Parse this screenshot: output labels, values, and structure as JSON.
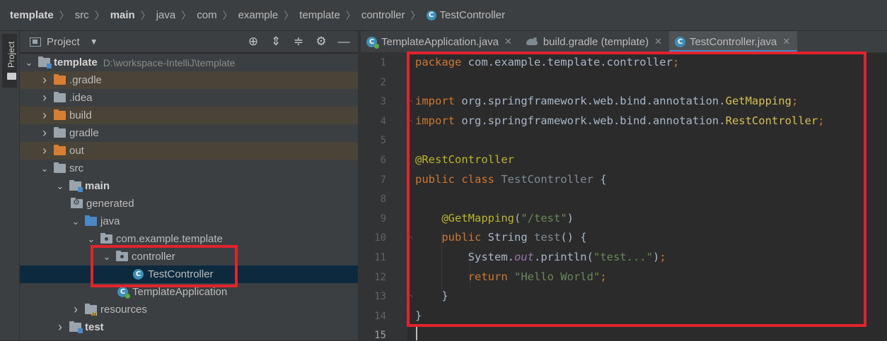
{
  "breadcrumb": [
    {
      "label": "template",
      "bold": true
    },
    {
      "label": "src",
      "bold": false
    },
    {
      "label": "main",
      "bold": true
    },
    {
      "label": "java",
      "bold": false
    },
    {
      "label": "com",
      "bold": false
    },
    {
      "label": "example",
      "bold": false
    },
    {
      "label": "template",
      "bold": false
    },
    {
      "label": "controller",
      "bold": false
    },
    {
      "label": "TestController",
      "bold": false,
      "class_icon": true
    }
  ],
  "tool_strip": {
    "project_label": "Project"
  },
  "project_panel": {
    "title": "Project",
    "toolbar_icons": [
      "crosshair-icon",
      "expand-all-icon",
      "collapse-all-icon",
      "settings-icon",
      "hide-icon"
    ]
  },
  "tree": [
    {
      "label": "template",
      "hint": "D:\\workspace-IntelliJ\\template",
      "bold": true,
      "arrow": "down",
      "folder": "module",
      "indent": 0
    },
    {
      "label": ".gradle",
      "arrow": "right",
      "folder": "orange",
      "indent": 1,
      "excluded": true
    },
    {
      "label": ".idea",
      "arrow": "right",
      "folder": "gray",
      "indent": 1
    },
    {
      "label": "build",
      "arrow": "right",
      "folder": "orange",
      "indent": 1,
      "excluded": true
    },
    {
      "label": "gradle",
      "arrow": "right",
      "folder": "gray",
      "indent": 1
    },
    {
      "label": "out",
      "arrow": "right",
      "folder": "orange",
      "indent": 1,
      "excluded": true
    },
    {
      "label": "src",
      "arrow": "down",
      "folder": "gray",
      "indent": 1
    },
    {
      "label": "main",
      "bold": true,
      "arrow": "down",
      "folder": "module",
      "indent": 2
    },
    {
      "label": "generated",
      "arrow": "none",
      "folder": "gen",
      "indent": 3
    },
    {
      "label": "java",
      "arrow": "down",
      "folder": "blue",
      "indent": 3
    },
    {
      "label": "com.example.template",
      "arrow": "down",
      "folder": "pkg",
      "indent": 4
    },
    {
      "label": "controller",
      "arrow": "down",
      "folder": "pkg",
      "indent": 5
    },
    {
      "label": "TestController",
      "arrow": "none",
      "folder": "class",
      "indent": 7,
      "selected": true
    },
    {
      "label": "TemplateApplication",
      "arrow": "none",
      "folder": "app",
      "indent": 6
    },
    {
      "label": "resources",
      "arrow": "right",
      "folder": "res",
      "indent": 3
    },
    {
      "label": "test",
      "bold": true,
      "arrow": "right",
      "folder": "module",
      "indent": 2
    }
  ],
  "tabs": [
    {
      "label": "TemplateApplication.java",
      "icon": "app",
      "active": false
    },
    {
      "label": "build.gradle (template)",
      "icon": "gradle",
      "active": false
    },
    {
      "label": "TestController.java",
      "icon": "class",
      "active": true
    }
  ],
  "tab_close_glyph": "✕",
  "code_lines": [
    {
      "n": "1",
      "tokens": [
        [
          "kw",
          "package "
        ],
        [
          "plain",
          "com.example.template.controller"
        ],
        [
          "kw",
          ";"
        ]
      ]
    },
    {
      "n": "2",
      "tokens": []
    },
    {
      "n": "3",
      "tokens": [
        [
          "kw",
          "import "
        ],
        [
          "plain",
          "org.springframework.web.bind.annotation."
        ],
        [
          "yellow",
          "GetMapping"
        ],
        [
          "kw",
          ";"
        ]
      ]
    },
    {
      "n": "4",
      "tokens": [
        [
          "kw",
          "import "
        ],
        [
          "plain",
          "org.springframework.web.bind.annotation."
        ],
        [
          "yellow",
          "RestController"
        ],
        [
          "kw",
          ";"
        ]
      ]
    },
    {
      "n": "5",
      "tokens": []
    },
    {
      "n": "6",
      "tokens": [
        [
          "ann",
          "@RestController"
        ]
      ]
    },
    {
      "n": "7",
      "tokens": [
        [
          "kw",
          "public class "
        ],
        [
          "dim",
          "TestController "
        ],
        [
          "plain",
          "{"
        ]
      ]
    },
    {
      "n": "8",
      "tokens": []
    },
    {
      "n": "9",
      "tokens": [
        [
          "plain",
          "    "
        ],
        [
          "ann",
          "@GetMapping"
        ],
        [
          "plain",
          "("
        ],
        [
          "str",
          "\"/test\""
        ],
        [
          "plain",
          ")"
        ]
      ]
    },
    {
      "n": "10",
      "tokens": [
        [
          "plain",
          "    "
        ],
        [
          "kw",
          "public "
        ],
        [
          "plain",
          "String "
        ],
        [
          "dim",
          "test"
        ],
        [
          "plain",
          "() {"
        ]
      ]
    },
    {
      "n": "11",
      "tokens": [
        [
          "plain",
          "        System."
        ],
        [
          "italic",
          "out"
        ],
        [
          "plain",
          ".println("
        ],
        [
          "str",
          "\"test...\""
        ],
        [
          "plain",
          ")"
        ],
        [
          "kw",
          ";"
        ]
      ]
    },
    {
      "n": "12",
      "tokens": [
        [
          "plain",
          "        "
        ],
        [
          "kw",
          "return "
        ],
        [
          "str",
          "\"Hello World\""
        ],
        [
          "kw",
          ";"
        ]
      ]
    },
    {
      "n": "13",
      "tokens": [
        [
          "plain",
          "    }"
        ]
      ]
    },
    {
      "n": "14",
      "tokens": [
        [
          "plain",
          "}"
        ]
      ]
    },
    {
      "n": "15",
      "tokens": []
    }
  ],
  "current_line": "15",
  "colors": {
    "highlight_box": "#e0232d",
    "selection": "#0d293e",
    "accent": "#4a88c7"
  }
}
